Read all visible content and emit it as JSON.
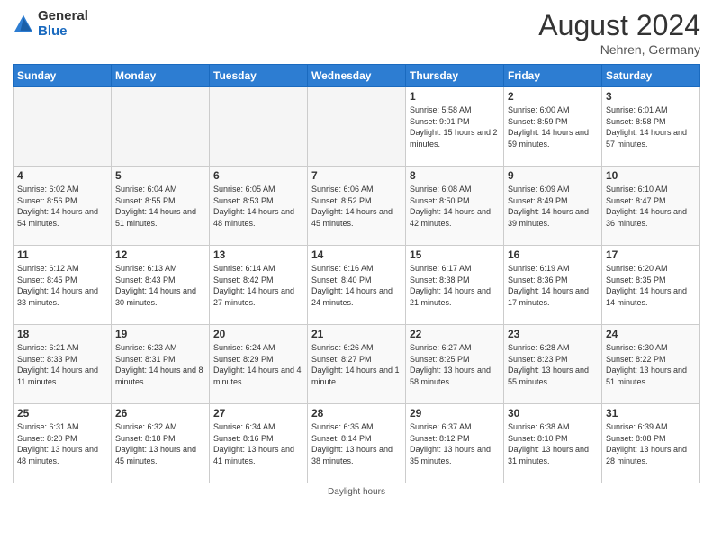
{
  "header": {
    "logo_general": "General",
    "logo_blue": "Blue",
    "month_year": "August 2024",
    "location": "Nehren, Germany"
  },
  "days_of_week": [
    "Sunday",
    "Monday",
    "Tuesday",
    "Wednesday",
    "Thursday",
    "Friday",
    "Saturday"
  ],
  "footer": {
    "note": "Daylight hours"
  },
  "weeks": [
    {
      "days": [
        {
          "num": "",
          "empty": true
        },
        {
          "num": "",
          "empty": true
        },
        {
          "num": "",
          "empty": true
        },
        {
          "num": "",
          "empty": true
        },
        {
          "num": "1",
          "sunrise": "5:58 AM",
          "sunset": "9:01 PM",
          "daylight": "15 hours and 2 minutes."
        },
        {
          "num": "2",
          "sunrise": "6:00 AM",
          "sunset": "8:59 PM",
          "daylight": "14 hours and 59 minutes."
        },
        {
          "num": "3",
          "sunrise": "6:01 AM",
          "sunset": "8:58 PM",
          "daylight": "14 hours and 57 minutes."
        }
      ]
    },
    {
      "days": [
        {
          "num": "4",
          "sunrise": "6:02 AM",
          "sunset": "8:56 PM",
          "daylight": "14 hours and 54 minutes."
        },
        {
          "num": "5",
          "sunrise": "6:04 AM",
          "sunset": "8:55 PM",
          "daylight": "14 hours and 51 minutes."
        },
        {
          "num": "6",
          "sunrise": "6:05 AM",
          "sunset": "8:53 PM",
          "daylight": "14 hours and 48 minutes."
        },
        {
          "num": "7",
          "sunrise": "6:06 AM",
          "sunset": "8:52 PM",
          "daylight": "14 hours and 45 minutes."
        },
        {
          "num": "8",
          "sunrise": "6:08 AM",
          "sunset": "8:50 PM",
          "daylight": "14 hours and 42 minutes."
        },
        {
          "num": "9",
          "sunrise": "6:09 AM",
          "sunset": "8:49 PM",
          "daylight": "14 hours and 39 minutes."
        },
        {
          "num": "10",
          "sunrise": "6:10 AM",
          "sunset": "8:47 PM",
          "daylight": "14 hours and 36 minutes."
        }
      ]
    },
    {
      "days": [
        {
          "num": "11",
          "sunrise": "6:12 AM",
          "sunset": "8:45 PM",
          "daylight": "14 hours and 33 minutes."
        },
        {
          "num": "12",
          "sunrise": "6:13 AM",
          "sunset": "8:43 PM",
          "daylight": "14 hours and 30 minutes."
        },
        {
          "num": "13",
          "sunrise": "6:14 AM",
          "sunset": "8:42 PM",
          "daylight": "14 hours and 27 minutes."
        },
        {
          "num": "14",
          "sunrise": "6:16 AM",
          "sunset": "8:40 PM",
          "daylight": "14 hours and 24 minutes."
        },
        {
          "num": "15",
          "sunrise": "6:17 AM",
          "sunset": "8:38 PM",
          "daylight": "14 hours and 21 minutes."
        },
        {
          "num": "16",
          "sunrise": "6:19 AM",
          "sunset": "8:36 PM",
          "daylight": "14 hours and 17 minutes."
        },
        {
          "num": "17",
          "sunrise": "6:20 AM",
          "sunset": "8:35 PM",
          "daylight": "14 hours and 14 minutes."
        }
      ]
    },
    {
      "days": [
        {
          "num": "18",
          "sunrise": "6:21 AM",
          "sunset": "8:33 PM",
          "daylight": "14 hours and 11 minutes."
        },
        {
          "num": "19",
          "sunrise": "6:23 AM",
          "sunset": "8:31 PM",
          "daylight": "14 hours and 8 minutes."
        },
        {
          "num": "20",
          "sunrise": "6:24 AM",
          "sunset": "8:29 PM",
          "daylight": "14 hours and 4 minutes."
        },
        {
          "num": "21",
          "sunrise": "6:26 AM",
          "sunset": "8:27 PM",
          "daylight": "14 hours and 1 minute."
        },
        {
          "num": "22",
          "sunrise": "6:27 AM",
          "sunset": "8:25 PM",
          "daylight": "13 hours and 58 minutes."
        },
        {
          "num": "23",
          "sunrise": "6:28 AM",
          "sunset": "8:23 PM",
          "daylight": "13 hours and 55 minutes."
        },
        {
          "num": "24",
          "sunrise": "6:30 AM",
          "sunset": "8:22 PM",
          "daylight": "13 hours and 51 minutes."
        }
      ]
    },
    {
      "days": [
        {
          "num": "25",
          "sunrise": "6:31 AM",
          "sunset": "8:20 PM",
          "daylight": "13 hours and 48 minutes."
        },
        {
          "num": "26",
          "sunrise": "6:32 AM",
          "sunset": "8:18 PM",
          "daylight": "13 hours and 45 minutes."
        },
        {
          "num": "27",
          "sunrise": "6:34 AM",
          "sunset": "8:16 PM",
          "daylight": "13 hours and 41 minutes."
        },
        {
          "num": "28",
          "sunrise": "6:35 AM",
          "sunset": "8:14 PM",
          "daylight": "13 hours and 38 minutes."
        },
        {
          "num": "29",
          "sunrise": "6:37 AM",
          "sunset": "8:12 PM",
          "daylight": "13 hours and 35 minutes."
        },
        {
          "num": "30",
          "sunrise": "6:38 AM",
          "sunset": "8:10 PM",
          "daylight": "13 hours and 31 minutes."
        },
        {
          "num": "31",
          "sunrise": "6:39 AM",
          "sunset": "8:08 PM",
          "daylight": "13 hours and 28 minutes."
        }
      ]
    }
  ]
}
